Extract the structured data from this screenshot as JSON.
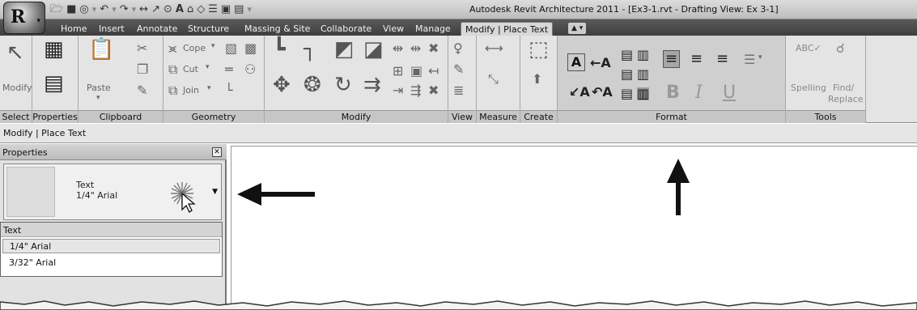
{
  "window": {
    "title": "Autodesk Revit Architecture 2011 - [Ex3-1.rvt - Drafting View: Ex 3-1]"
  },
  "quick_access": [
    "open-icon",
    "save-icon",
    "sync-icon",
    "undo-icon",
    "redo-icon",
    "measure-icon",
    "dimension-icon",
    "tag-icon",
    "text-icon",
    "3d-view-icon",
    "section-icon",
    "thin-lines-icon",
    "close-views-icon",
    "switch-windows-icon",
    "customize-icon"
  ],
  "ribbon": {
    "tabs": [
      {
        "label": "Home"
      },
      {
        "label": "Insert"
      },
      {
        "label": "Annotate"
      },
      {
        "label": "Structure"
      },
      {
        "label": "Massing & Site"
      },
      {
        "label": "Collaborate"
      },
      {
        "label": "View"
      },
      {
        "label": "Manage"
      },
      {
        "label": "Modify | Place Text"
      }
    ],
    "panels": {
      "select": {
        "label": "Select",
        "modify_label": "Modify"
      },
      "properties": {
        "label": "Properties"
      },
      "clipboard": {
        "label": "Clipboard",
        "paste_label": "Paste"
      },
      "geometry": {
        "label": "Geometry",
        "cope_label": "Cope",
        "cut_label": "Cut",
        "join_label": "Join"
      },
      "modify": {
        "label": "Modify"
      },
      "view": {
        "label": "View"
      },
      "measure": {
        "label": "Measure"
      },
      "create": {
        "label": "Create"
      },
      "format": {
        "label": "Format",
        "bold": "B",
        "italic": "I",
        "underline": "U"
      },
      "tools": {
        "label": "Tools",
        "spelling_label": "Spelling",
        "find_label": "Find/",
        "replace_label": "Replace"
      }
    }
  },
  "options_bar": {
    "text": "Modify | Place Text"
  },
  "properties_palette": {
    "title": "Properties",
    "type_family": "Text",
    "type_name": "1/4\" Arial",
    "dropdown": {
      "header": "Text",
      "items": [
        {
          "label": "1/4\" Arial",
          "selected": true
        },
        {
          "label": "3/32\" Arial",
          "selected": false
        }
      ]
    }
  },
  "colors": {
    "tab_bar": "#4a4a4a",
    "ribbon_bg": "#e4e4e4",
    "highlight_panel": "#cfcfcf"
  }
}
